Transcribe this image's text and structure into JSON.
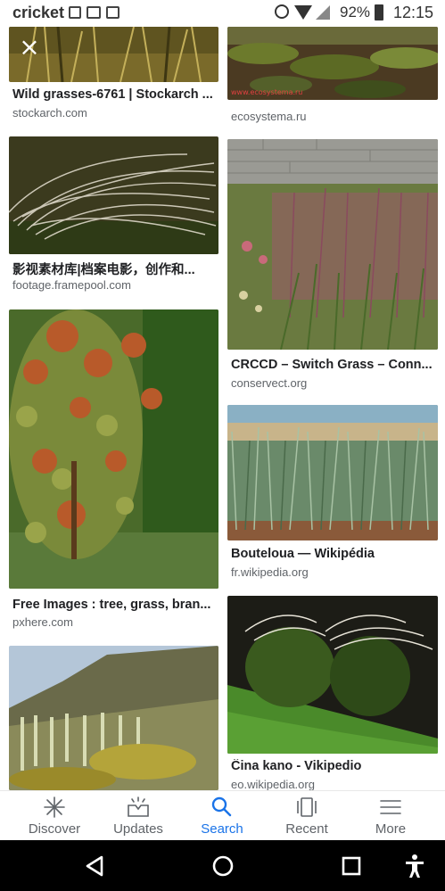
{
  "status_bar": {
    "carrier": "cricket",
    "battery": "92%",
    "time": "12:15"
  },
  "results": [
    {
      "title": "Wild grasses-6761 | Stockarch ...",
      "source": "stockarch.com",
      "close_label": "×"
    },
    {
      "title": "",
      "source": "ecosystema.ru",
      "watermark": "www.ecosystema.ru"
    },
    {
      "title": "影视素材库|档案电影，创作和...",
      "source": "footage.framepool.com"
    },
    {
      "title": "CRCCD – Switch Grass – Conn...",
      "source": "conservect.org"
    },
    {
      "title": "Free Images : tree, grass, bran...",
      "source": "pxhere.com"
    },
    {
      "title": "Bouteloua — Wikipédia",
      "source": "fr.wikipedia.org"
    },
    {
      "title": "",
      "source": ""
    },
    {
      "title": "Ĉina kano - Vikipedio",
      "source": "eo.wikipedia.org"
    }
  ],
  "bottom_nav": {
    "items": [
      {
        "label": "Discover",
        "icon": "asterisk-icon"
      },
      {
        "label": "Updates",
        "icon": "inbox-icon"
      },
      {
        "label": "Search",
        "icon": "search-icon",
        "active": true
      },
      {
        "label": "Recent",
        "icon": "recent-icon"
      },
      {
        "label": "More",
        "icon": "menu-icon"
      }
    ]
  },
  "colors": {
    "accent": "#1a73e8",
    "text": "#202124",
    "muted": "#5f6368"
  }
}
